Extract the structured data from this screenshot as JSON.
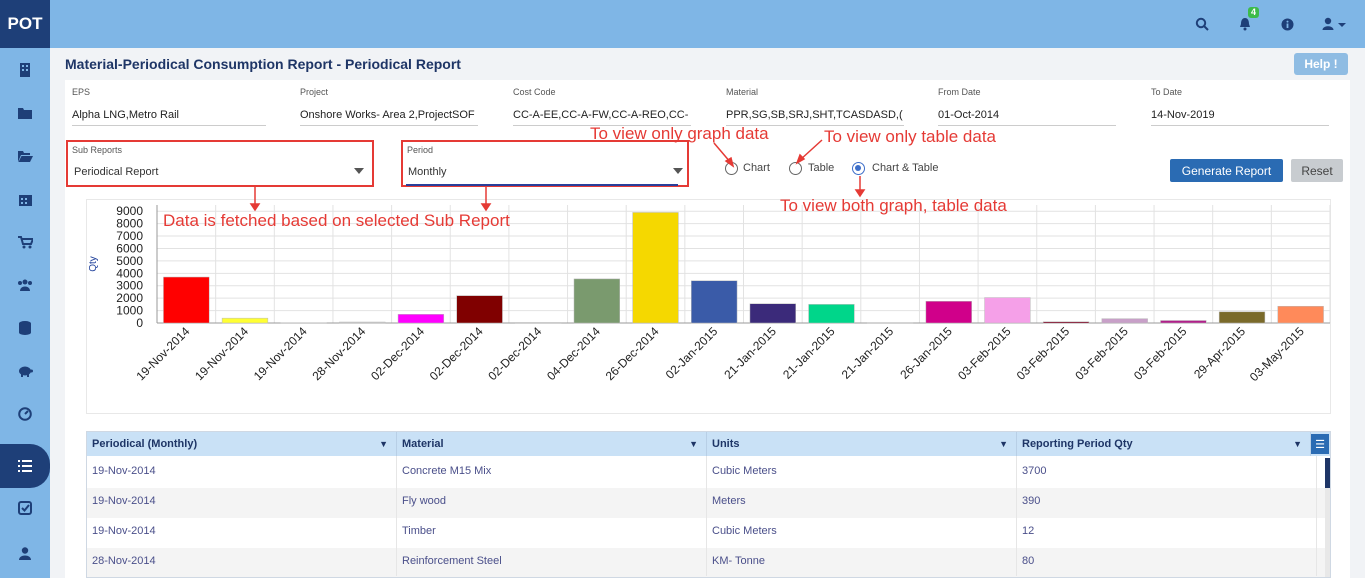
{
  "app": {
    "brand": "POT",
    "notification_count": "4"
  },
  "top_icons": [
    "search-icon",
    "bell-icon",
    "info-icon",
    "user-icon"
  ],
  "sidebar_icons": [
    "building-icon",
    "folder-icon",
    "folder-open-icon",
    "calendar-icon",
    "cart-icon",
    "users-icon",
    "database-icon",
    "piggy-bank-icon",
    "dashboard-icon",
    "list-icon",
    "checkbox-icon",
    "user-icon"
  ],
  "page": {
    "title": "Material-Periodical Consumption Report - Periodical Report",
    "help_label": "Help !"
  },
  "filters": {
    "eps": {
      "label": "EPS",
      "value": "Alpha LNG,Metro Rail"
    },
    "project": {
      "label": "Project",
      "value": "Onshore  Works- Area 2,ProjectSOF"
    },
    "cost_code": {
      "label": "Cost Code",
      "value": "CC-A-EE,CC-A-FW,CC-A-REO,CC-"
    },
    "material": {
      "label": "Material",
      "value": "PPR,SG,SB,SRJ,SHT,TCASDASD,("
    },
    "from_date": {
      "label": "From Date",
      "value": "01-Oct-2014"
    },
    "to_date": {
      "label": "To Date",
      "value": "14-Nov-2019"
    },
    "sub_reports": {
      "label": "Sub Reports",
      "value": "Periodical Report"
    },
    "period": {
      "label": "Period",
      "value": "Monthly"
    }
  },
  "view_options": [
    {
      "label": "Chart",
      "checked": false
    },
    {
      "label": "Table",
      "checked": false
    },
    {
      "label": "Chart & Table",
      "checked": true
    }
  ],
  "buttons": {
    "generate": "Generate Report",
    "reset": "Reset"
  },
  "annotations": {
    "graph_only": "To view only graph data",
    "table_only": "To view only table data",
    "both": "To view both graph, table data",
    "sub_report": "Data is fetched based on selected Sub Report"
  },
  "colors": {
    "accent": "#2a6bb3",
    "header_bg": "#7fb6e6",
    "brand_bg": "#1e3f78",
    "annotation": "#e53a35"
  },
  "chart_data": {
    "type": "bar",
    "ylabel": "Qty",
    "ylim": [
      0,
      9500
    ],
    "yticks": [
      0,
      1000,
      2000,
      3000,
      4000,
      5000,
      6000,
      7000,
      8000,
      9000
    ],
    "grid": true,
    "categories": [
      "19-Nov-2014",
      "19-Nov-2014",
      "19-Nov-2014",
      "28-Nov-2014",
      "02-Dec-2014",
      "02-Dec-2014",
      "02-Dec-2014",
      "04-Dec-2014",
      "26-Dec-2014",
      "02-Jan-2015",
      "21-Jan-2015",
      "21-Jan-2015",
      "21-Jan-2015",
      "26-Jan-2015",
      "03-Feb-2015",
      "03-Feb-2015",
      "03-Feb-2015",
      "03-Feb-2015",
      "29-Apr-2015",
      "03-May-2015"
    ],
    "values": [
      3700,
      390,
      12,
      80,
      700,
      2200,
      40,
      3550,
      8900,
      3400,
      1550,
      1500,
      30,
      1750,
      2050,
      100,
      350,
      200,
      900,
      1350
    ],
    "colors": [
      "#ff0000",
      "#ffff33",
      "#cccccc",
      "#cccccc",
      "#ff00ff",
      "#800000",
      "#cccccc",
      "#7a9a6e",
      "#f5d800",
      "#3a5ba8",
      "#3b2a7a",
      "#00d68a",
      "#cccccc",
      "#d0008a",
      "#f5a0e8",
      "#800020",
      "#c8a0c8",
      "#b0208a",
      "#7a6a2a",
      "#ff8a5a"
    ]
  },
  "table": {
    "headers": [
      "Periodical (Monthly)",
      "Material",
      "Units",
      "Reporting Period Qty"
    ],
    "rows": [
      [
        "19-Nov-2014",
        "Concrete M15 Mix",
        "Cubic Meters",
        "3700"
      ],
      [
        "19-Nov-2014",
        "Fly wood",
        "Meters",
        "390"
      ],
      [
        "19-Nov-2014",
        "Timber",
        "Cubic Meters",
        "12"
      ],
      [
        "28-Nov-2014",
        "Reinforcement Steel",
        "KM- Tonne",
        "80"
      ]
    ]
  }
}
